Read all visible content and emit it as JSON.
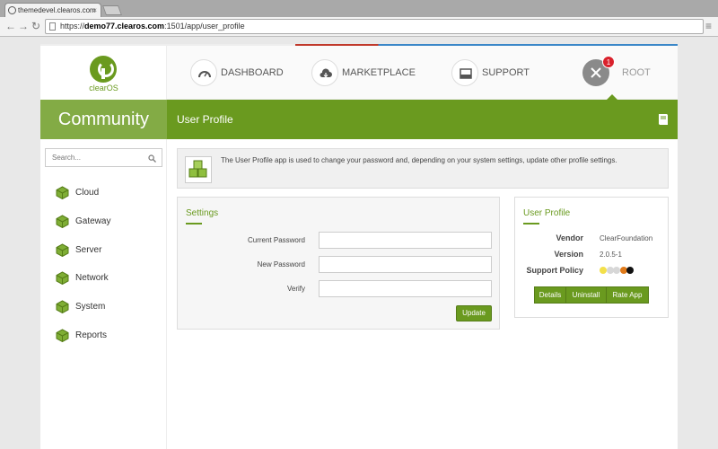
{
  "browser": {
    "tab_title": "themedevel.clearos.com",
    "tab_close": "×",
    "url_prefix": "https://",
    "url_host": "demo77.clearos.com",
    "url_path": ":1501/app/user_profile",
    "back": "←",
    "forward": "→",
    "reload": "↻",
    "menu": "≡"
  },
  "logo": {
    "text": "clearOS"
  },
  "nav": [
    {
      "label": "DASHBOARD",
      "icon": "dashboard-icon"
    },
    {
      "label": "MARKETPLACE",
      "icon": "cloud-download-icon"
    },
    {
      "label": "SUPPORT",
      "icon": "inbox-icon"
    },
    {
      "label": "ROOT",
      "icon": "tools-icon",
      "badge": "1"
    }
  ],
  "banner": {
    "edition": "Community",
    "page_title": "User Profile",
    "icon": "book-icon"
  },
  "sidebar": {
    "search_placeholder": "Search...",
    "items": [
      {
        "label": "Cloud"
      },
      {
        "label": "Gateway"
      },
      {
        "label": "Server"
      },
      {
        "label": "Network"
      },
      {
        "label": "System"
      },
      {
        "label": "Reports"
      }
    ]
  },
  "info": {
    "text": "The User Profile app is used to change your password and, depending on your system settings, update other profile settings."
  },
  "settings": {
    "title": "Settings",
    "fields": [
      {
        "label": "Current Password",
        "value": ""
      },
      {
        "label": "New Password",
        "value": ""
      },
      {
        "label": "Verify",
        "value": ""
      }
    ],
    "update_label": "Update"
  },
  "profile": {
    "title": "User Profile",
    "vendor_label": "Vendor",
    "vendor": "ClearFoundation",
    "version_label": "Version",
    "version": "2.0.5-1",
    "support_label": "Support Policy",
    "support_colors": [
      "#f3e04a",
      "#d7d7d7",
      "#d7d7d7",
      "#e07a1a",
      "#111111"
    ],
    "buttons": [
      "Details",
      "Uninstall",
      "Rate App"
    ]
  },
  "colors": {
    "accent": "#6a9a1f",
    "accent_light": "#83ab45",
    "badge": "#d9212c"
  }
}
